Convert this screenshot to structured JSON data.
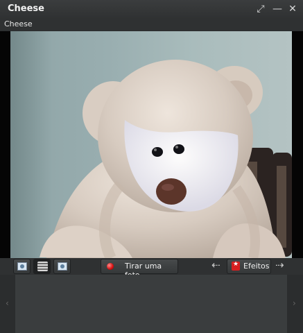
{
  "window": {
    "title": "Cheese",
    "menu_label": "Cheese",
    "controls": {
      "fullscreen_icon": "⤢",
      "minimize_icon": "—",
      "close_icon": "✕"
    }
  },
  "camera": {
    "subject": "teddy bear"
  },
  "toolbar": {
    "modes": [
      {
        "name": "photo-mode-icon"
      },
      {
        "name": "video-mode-icon"
      },
      {
        "name": "burst-mode-icon"
      }
    ],
    "take_photo_label": "Tirar uma foto",
    "effects_label": "Efeitos",
    "left_arrow": "⇠",
    "right_arrow": "⇢"
  },
  "thumbnail_area": {
    "left_arrow": "‹",
    "right_arrow": "›"
  }
}
